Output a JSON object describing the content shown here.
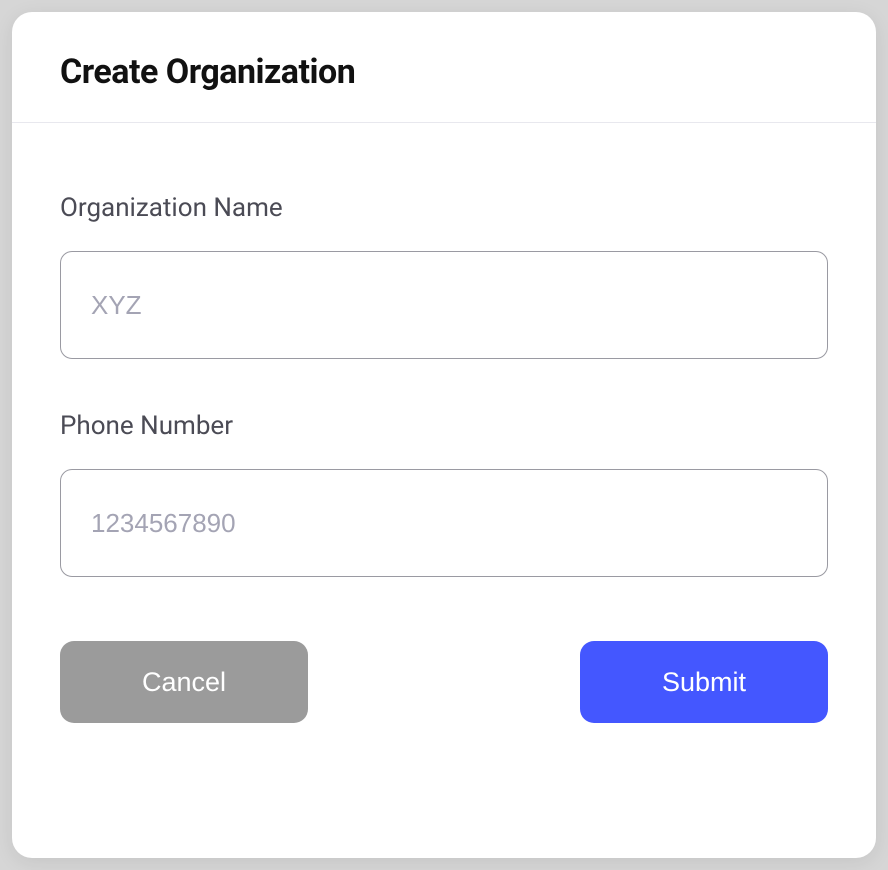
{
  "modal": {
    "title": "Create Organization",
    "fields": {
      "org_name": {
        "label": "Organization Name",
        "placeholder": "XYZ",
        "value": ""
      },
      "phone_number": {
        "label": "Phone Number",
        "placeholder": "1234567890",
        "value": ""
      }
    },
    "buttons": {
      "cancel_label": "Cancel",
      "submit_label": "Submit"
    }
  }
}
